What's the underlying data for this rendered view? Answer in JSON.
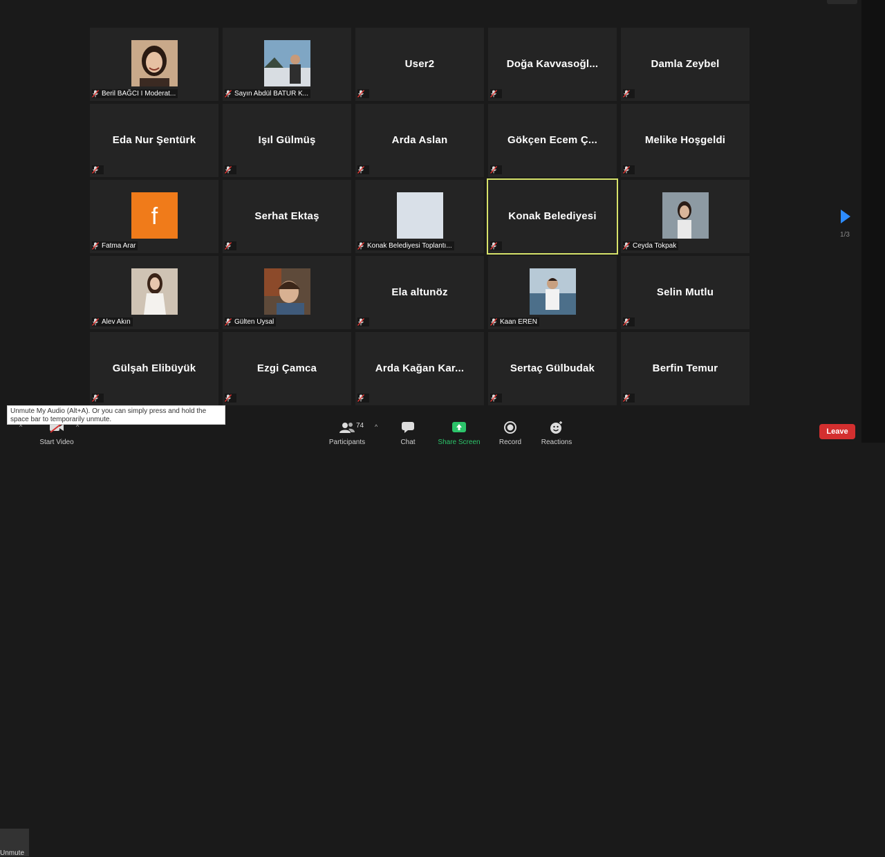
{
  "participants": [
    {
      "name": "Beril BAĞCI I Moderat...",
      "display": "",
      "avatar": "photo-woman-smiling"
    },
    {
      "name": "Sayın Abdül BATUR K...",
      "display": "",
      "avatar": "photo-man-outdoors"
    },
    {
      "name": "",
      "display": "User2",
      "avatar": ""
    },
    {
      "name": "",
      "display": "Doğa  Kavvasoğl...",
      "avatar": ""
    },
    {
      "name": "",
      "display": "Damla Zeybel",
      "avatar": ""
    },
    {
      "name": "",
      "display": "Eda Nur Şentürk",
      "avatar": ""
    },
    {
      "name": "",
      "display": "Işıl Gülmüş",
      "avatar": ""
    },
    {
      "name": "",
      "display": "Arda Aslan",
      "avatar": ""
    },
    {
      "name": "",
      "display": "Gökçen  Ecem  Ç...",
      "avatar": ""
    },
    {
      "name": "",
      "display": "Melike Hoşgeldi",
      "avatar": ""
    },
    {
      "name": "Fatma Arar",
      "display": "",
      "avatar": "facebook-logo"
    },
    {
      "name": "",
      "display": "Serhat Ektaş",
      "avatar": ""
    },
    {
      "name": "Konak Belediyesi Toplantı...",
      "display": "",
      "avatar": "blank-light"
    },
    {
      "name": "",
      "display": "Konak Belediyesi",
      "avatar": "",
      "active": true
    },
    {
      "name": "Ceyda Tokpak",
      "display": "",
      "avatar": "photo-woman-wall"
    },
    {
      "name": "Alev Akın",
      "display": "",
      "avatar": "photo-woman-white-dress"
    },
    {
      "name": "Gülten Uysal",
      "display": "",
      "avatar": "photo-woman-selfie"
    },
    {
      "name": "",
      "display": "Ela altunöz",
      "avatar": ""
    },
    {
      "name": "Kaan EREN",
      "display": "",
      "avatar": "photo-man-sea"
    },
    {
      "name": "",
      "display": "Selin Mutlu",
      "avatar": ""
    },
    {
      "name": "",
      "display": "Gülşah Elibüyük",
      "avatar": ""
    },
    {
      "name": "",
      "display": "Ezgi Çamca",
      "avatar": ""
    },
    {
      "name": "",
      "display": "Arda  Kağan  Kar...",
      "avatar": ""
    },
    {
      "name": "",
      "display": "Sertaç Gülbudak",
      "avatar": ""
    },
    {
      "name": "",
      "display": "Berfin Temur",
      "avatar": ""
    }
  ],
  "pagination": {
    "indicator": "1/3"
  },
  "toolbar": {
    "unmute_label": "Unmute",
    "start_video_label": "Start Video",
    "participants_label": "Participants",
    "participants_count": "74",
    "chat_label": "Chat",
    "share_screen_label": "Share Screen",
    "record_label": "Record",
    "reactions_label": "Reactions",
    "leave_label": "Leave"
  },
  "tooltip": {
    "text": "Unmute My Audio (Alt+A). Or you can simply press and hold the space bar to temporarily unmute."
  },
  "colors": {
    "active_speaker": "#d7e36a",
    "share_green": "#2cc46a",
    "leave_red": "#d32f2f",
    "arrow_blue": "#2d8cff"
  }
}
